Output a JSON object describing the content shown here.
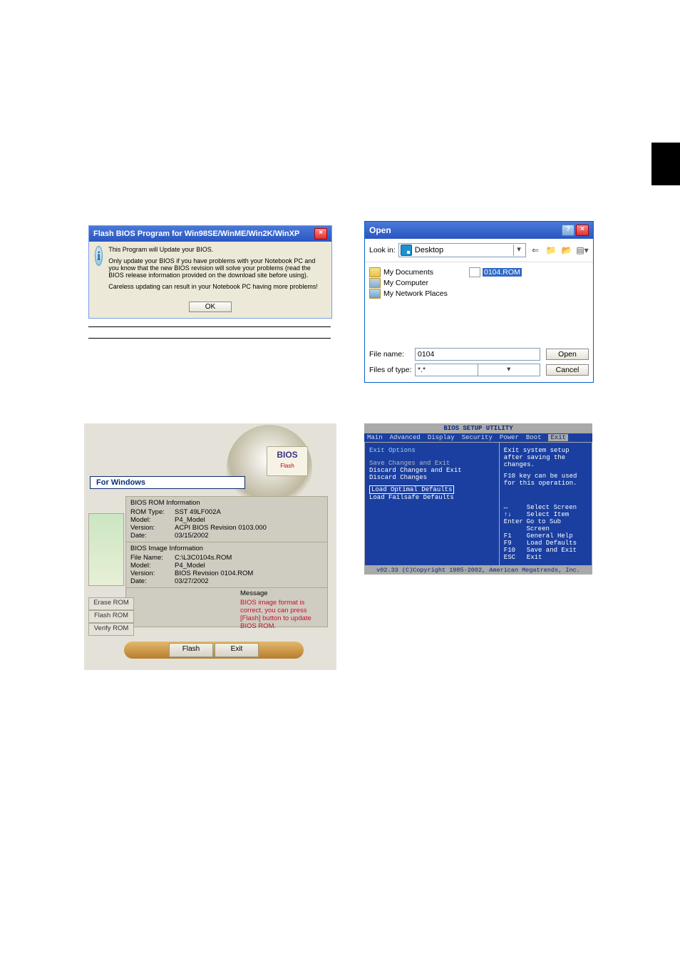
{
  "flashPrompt": {
    "title": "Flash BIOS Program for Win98SE/WinME/Win2K/WinXP",
    "line1": "This Program will Update your BIOS.",
    "line2": "Only update your BIOS if you have problems with your Notebook PC and you know that the new BIOS revision will solve your problems (read the BIOS release information provided on the download site before using).",
    "line3": "Careless updating can result in your Notebook PC having more problems!",
    "ok": "OK"
  },
  "openDlg": {
    "title": "Open",
    "lookInLabel": "Look in:",
    "lookInValue": "Desktop",
    "items": {
      "docs": "My Documents",
      "comp": "My Computer",
      "net": "My Network Places",
      "sel": "0104.ROM"
    },
    "fileNameLabel": "File name:",
    "fileNameValue": "0104",
    "filesTypeLabel": "Files of type:",
    "filesTypeValue": "*.*",
    "openBtn": "Open",
    "cancelBtn": "Cancel"
  },
  "flashApp": {
    "logo": "BIOS",
    "logoSub": "Flash",
    "forWin": "For Windows",
    "romInfo": {
      "header": "BIOS ROM Information",
      "romType": {
        "k": "ROM Type:",
        "v": "SST 49LF002A"
      },
      "model": {
        "k": "Model:",
        "v": "P4_Model"
      },
      "version": {
        "k": "Version:",
        "v": "ACPI BIOS Revision 0103.000"
      },
      "date": {
        "k": "Date:",
        "v": "03/15/2002"
      }
    },
    "imgInfo": {
      "header": "BIOS Image Information",
      "fileName": {
        "k": "File Name:",
        "v": "C:\\L3C0104s.ROM"
      },
      "model": {
        "k": "Model:",
        "v": "P4_Model"
      },
      "version": {
        "k": "Version:",
        "v": "BIOS Revision 0104.ROM"
      },
      "date": {
        "k": "Date:",
        "v": "03/27/2002"
      }
    },
    "message": {
      "header": "Message",
      "text": "BIOS image format is correct, you can press [Flash] button to update BIOS ROM."
    },
    "side": {
      "erase": "Erase ROM",
      "flash": "Flash ROM",
      "verify": "Verify ROM"
    },
    "btns": {
      "flash": "Flash",
      "exit": "Exit"
    }
  },
  "biosSetup": {
    "title": "BIOS SETUP UTILITY",
    "menu": {
      "main": "Main",
      "advanced": "Advanced",
      "display": "Display",
      "security": "Security",
      "power": "Power",
      "boot": "Boot",
      "exit": "Exit"
    },
    "left": {
      "header": "Exit Options",
      "i1": "Save Changes and Exit",
      "i2": "Discard Changes and Exit",
      "i3": "Discard Changes",
      "i4": "Load Optimal Defaults",
      "i5": "Load Failsafe Defaults"
    },
    "help1": "Exit system setup after saving the changes.",
    "help2": "F10 key can be used for this operation.",
    "legend": {
      "l1": {
        "k": "↔",
        "d": "Select Screen"
      },
      "l2": {
        "k": "↑↓",
        "d": "Select Item"
      },
      "l3": {
        "k": "Enter",
        "d": "Go to Sub Screen"
      },
      "l4": {
        "k": "F1",
        "d": "General Help"
      },
      "l5": {
        "k": "F9",
        "d": "Load Defaults"
      },
      "l6": {
        "k": "F10",
        "d": "Save and Exit"
      },
      "l7": {
        "k": "ESC",
        "d": "Exit"
      }
    },
    "footer": "v02.33 (C)Copyright 1985-2002, American Megatrends, Inc."
  }
}
